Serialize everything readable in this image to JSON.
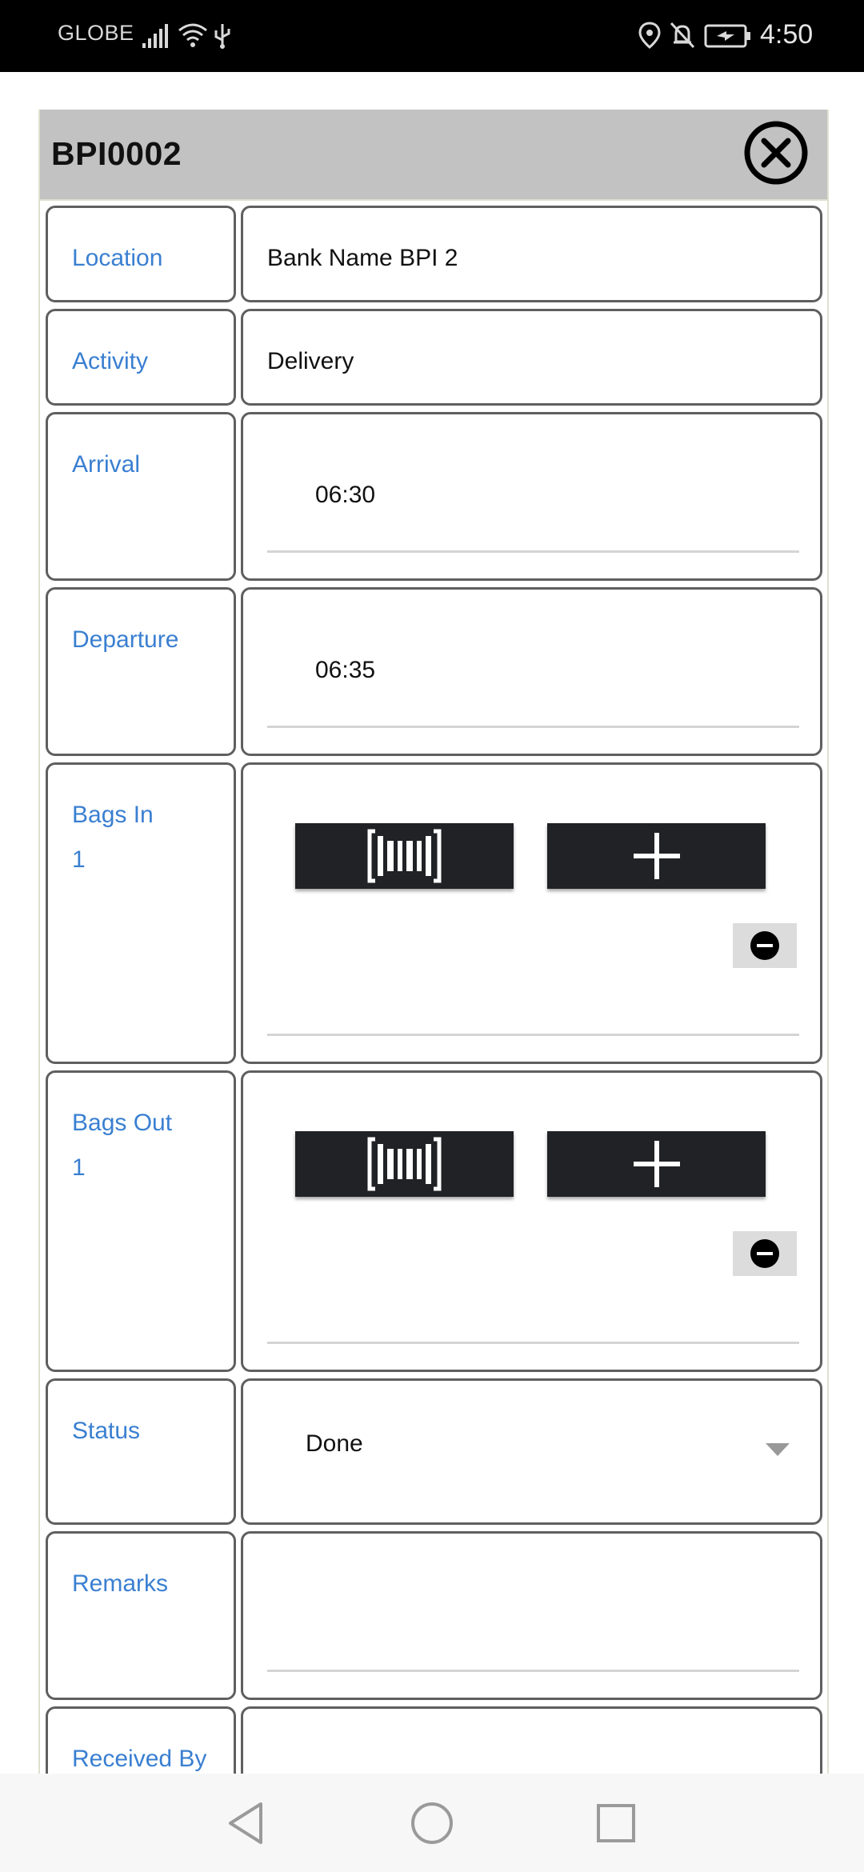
{
  "status_bar": {
    "carrier": "GLOBE",
    "time": "4:50",
    "icons": [
      "signal-icon",
      "wifi-icon",
      "usb-icon",
      "location-icon",
      "bell-off-icon",
      "battery-charging-icon"
    ]
  },
  "dialog": {
    "title": "BPI0002",
    "close_icon": "close-circle-icon"
  },
  "fields": {
    "location": {
      "label": "Location",
      "value": "Bank Name BPI 2"
    },
    "activity": {
      "label": "Activity",
      "value": "Delivery"
    },
    "arrival": {
      "label": "Arrival",
      "value": "06:30"
    },
    "departure": {
      "label": "Departure",
      "value": "06:35"
    },
    "bags_in": {
      "label": "Bags In",
      "count": "1",
      "scan_icon": "barcode-scan-icon",
      "add_icon": "plus-icon",
      "remove_icon": "minus-circle-icon"
    },
    "bags_out": {
      "label": "Bags Out",
      "count": "1",
      "scan_icon": "barcode-scan-icon",
      "add_icon": "plus-icon",
      "remove_icon": "minus-circle-icon"
    },
    "status": {
      "label": "Status",
      "value": "Done"
    },
    "remarks": {
      "label": "Remarks",
      "value": ""
    },
    "received_by": {
      "label": "Received By",
      "value": ""
    }
  },
  "nav_bar": {
    "icons": [
      "back-icon",
      "home-icon",
      "recents-icon"
    ]
  },
  "colors": {
    "label_blue": "#3a7fd1",
    "header_gray": "#c2c2c2",
    "button_dark": "#202226"
  }
}
